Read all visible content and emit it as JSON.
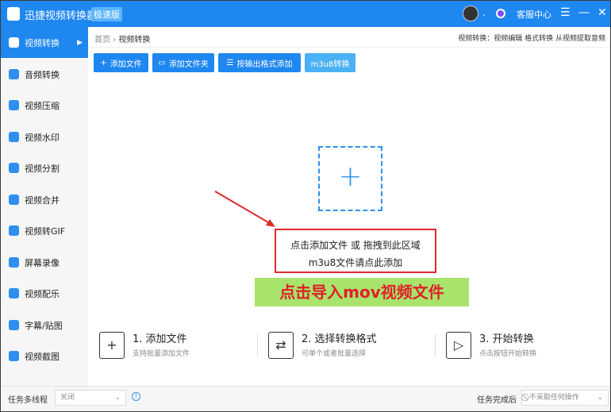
{
  "title": {
    "app_name": "迅捷视频转换器",
    "edition": "极速版",
    "service": "客服中心",
    "menu": "☰",
    "minimize": "—",
    "close": "✕",
    "dot": "."
  },
  "sidebar": {
    "items": [
      {
        "label": "视频转换"
      },
      {
        "label": "音频转换"
      },
      {
        "label": "视频压缩"
      },
      {
        "label": "视频水印"
      },
      {
        "label": "视频分割"
      },
      {
        "label": "视频合并"
      },
      {
        "label": "视频转GIF"
      },
      {
        "label": "屏幕录像"
      },
      {
        "label": "视频配乐"
      },
      {
        "label": "字幕/贴图"
      },
      {
        "label": "视频截图"
      }
    ]
  },
  "breadcrumb": {
    "home": "首页",
    "sep": " › ",
    "current": "视频转换"
  },
  "right_links": "视频转换：视频编辑 格式转换 从视频提取音频",
  "toolbar": {
    "add_file": "添加文件",
    "add_folder": "添加文件夹",
    "add_by_format": "按输出格式添加",
    "m3u8": "m3u8转换"
  },
  "drop": {
    "plus": "+",
    "line1": "点击添加文件 或 拖拽到此区域",
    "line2": "m3u8文件请点此添加"
  },
  "annotation": "点击导入mov视频文件",
  "steps": [
    {
      "title": "1. 添加文件",
      "sub": "支持批量添加文件",
      "icon": "+"
    },
    {
      "title": "2. 选择转换格式",
      "sub": "可单个或者批量选择",
      "icon": "⇄"
    },
    {
      "title": "3. 开始转换",
      "sub": "点击按钮开始转换",
      "icon": "▷"
    }
  ],
  "bottom": {
    "multithread_label": "任务多线程",
    "multithread_value": "关闭",
    "after_label": "任务完成后",
    "after_value": "⃠ 不采取任何操作",
    "info": "!"
  }
}
